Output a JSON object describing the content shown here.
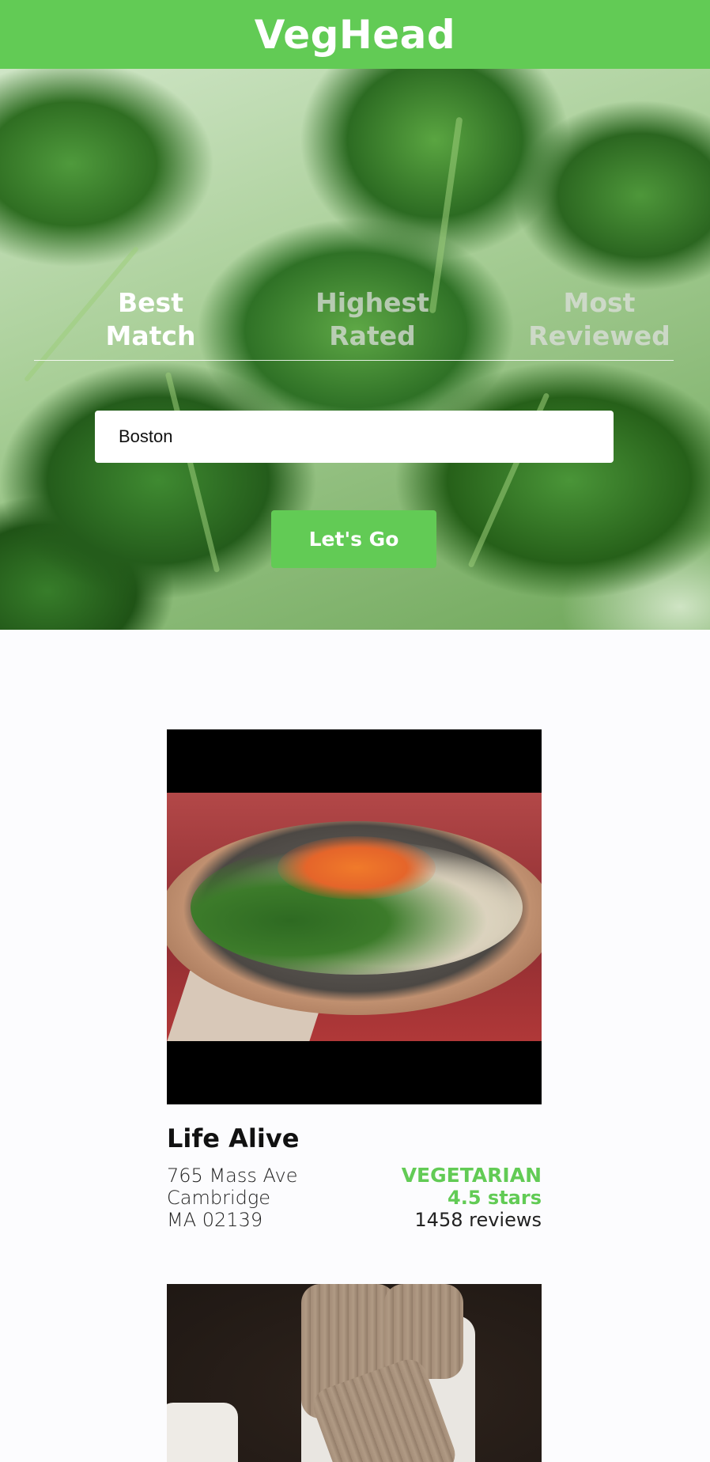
{
  "app": {
    "title": "VegHead",
    "accent_color": "#62cb55"
  },
  "sort_tabs": [
    {
      "label": "Best\nMatch",
      "active": true
    },
    {
      "label": "Highest\nRated",
      "active": false
    },
    {
      "label": "Most\nReviewed",
      "active": false
    }
  ],
  "search": {
    "value": "Boston",
    "placeholder": ""
  },
  "go_button": {
    "label": "Let's Go"
  },
  "results": [
    {
      "name": "Life Alive",
      "address_line1": "765 Mass Ave",
      "address_line2": "Cambridge",
      "address_line3": "MA 02139",
      "category": "VEGETARIAN",
      "rating": "4.5 stars",
      "reviews": "1458 reviews"
    }
  ]
}
